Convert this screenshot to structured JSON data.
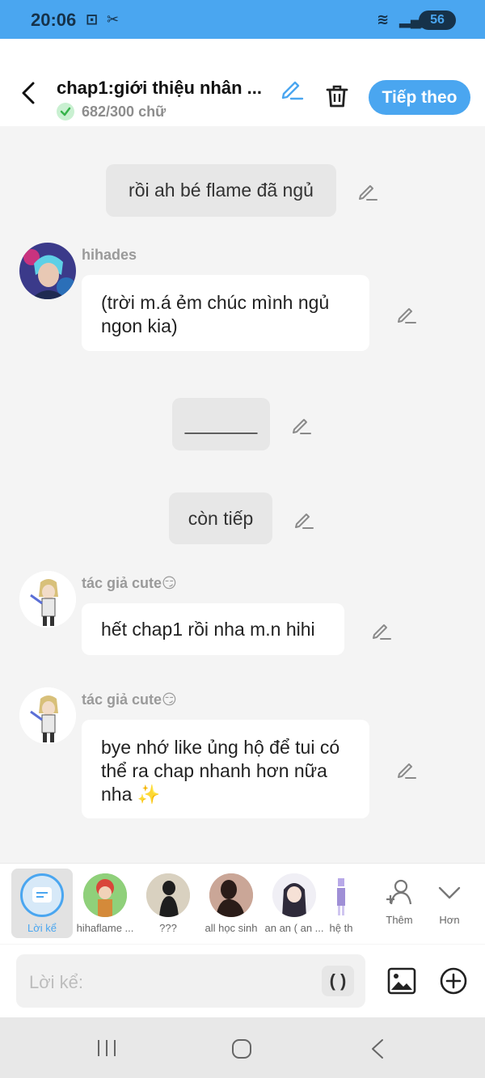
{
  "status_bar": {
    "time": "20:06",
    "battery": "56"
  },
  "header": {
    "title": "chap1:giới thiệu nhân ...",
    "word_count": "682/300 chữ",
    "next_label": "Tiếp theo"
  },
  "messages": [
    {
      "type": "narration",
      "text": "rồi ah bé flame đã ngủ"
    },
    {
      "type": "dialogue",
      "speaker": "hihades",
      "text": "(trời m.á ẻm chúc mình ngủ ngon kia)"
    },
    {
      "type": "narration",
      "text": "_______"
    },
    {
      "type": "narration",
      "text": "còn tiếp"
    },
    {
      "type": "dialogue",
      "speaker": "tác giả cute😏",
      "text": "hết chap1 rồi nha m.n hihi"
    },
    {
      "type": "dialogue",
      "speaker": "tác giả cute😏",
      "text": "bye nhớ like ủng hộ để tui có thể ra chap nhanh hơn nữa nha ✨"
    }
  ],
  "characters": [
    {
      "label": "Lời kể",
      "selected": true
    },
    {
      "label": "hihaflame ..."
    },
    {
      "label": "???"
    },
    {
      "label": "all học sinh"
    },
    {
      "label": "an an ( an ..."
    },
    {
      "label": "hệ th"
    }
  ],
  "char_actions": {
    "add_label": "Thêm",
    "more_label": "Hơn"
  },
  "input": {
    "placeholder": "Lời kể:",
    "paren_label": "( )"
  },
  "colors": {
    "accent": "#4aa6f0",
    "background": "#f4f4f4"
  }
}
